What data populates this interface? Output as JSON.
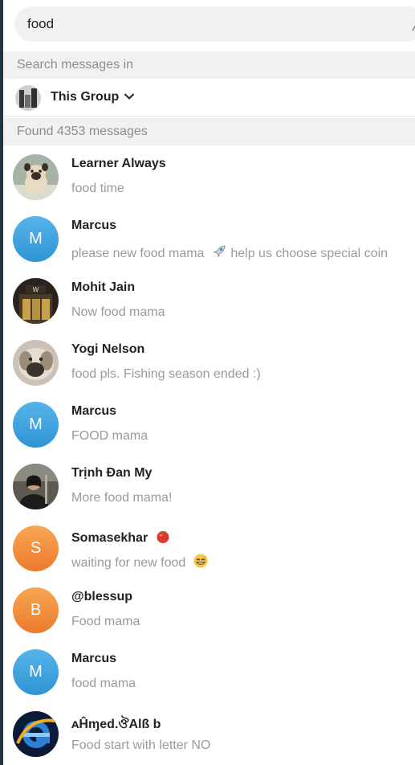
{
  "search": {
    "query": "food"
  },
  "scope": {
    "header": "Search messages in",
    "selected": "This Group"
  },
  "results_header": "Found 4353 messages",
  "colors": {
    "avatar_blue": "#3aa3de",
    "avatar_orange": "#f08d3a",
    "header_bg": "#f1f1f1",
    "muted_text": "#9a9a9a"
  },
  "results": [
    {
      "name": "Learner Always",
      "snippet": "food time",
      "avatar": {
        "type": "photo",
        "icon": "pug-photo"
      }
    },
    {
      "name": "Marcus",
      "snippet": "please new food mama",
      "snippet_after": "help us choose special coin",
      "snippet_emoji": "rocket-emoji",
      "avatar": {
        "type": "letter",
        "letter": "M",
        "color": "#3aa3de"
      }
    },
    {
      "name": "Mohit Jain",
      "snippet": "Now food mama",
      "avatar": {
        "type": "photo",
        "icon": "building-photo"
      }
    },
    {
      "name": "Yogi Nelson",
      "snippet": "food pls. Fishing season ended :)",
      "avatar": {
        "type": "photo",
        "icon": "dog-photo"
      }
    },
    {
      "name": "Marcus",
      "snippet": "FOOD mama",
      "avatar": {
        "type": "letter",
        "letter": "M",
        "color": "#3aa3de"
      }
    },
    {
      "name": "Trịnh Đan My",
      "snippet": "More food mama!",
      "avatar": {
        "type": "photo",
        "icon": "person-photo"
      }
    },
    {
      "name": "Somasekhar",
      "name_emoji": "tomato-emoji",
      "snippet": "waiting for new food",
      "snippet_emoji": "grinning-sweat-emoji",
      "avatar": {
        "type": "letter",
        "letter": "S",
        "color": "#f08d3a"
      }
    },
    {
      "name": "@blessup",
      "snippet": "Food mama",
      "avatar": {
        "type": "letter",
        "letter": "B",
        "color": "#f08d3a"
      }
    },
    {
      "name": "Marcus",
      "snippet": "food mama",
      "avatar": {
        "type": "letter",
        "letter": "M",
        "color": "#3aa3de"
      }
    },
    {
      "name": "ᴀĤɱed.ঔAlß  b",
      "snippet": "Food start with letter NO",
      "avatar": {
        "type": "photo",
        "icon": "internet-explorer-logo"
      }
    }
  ]
}
